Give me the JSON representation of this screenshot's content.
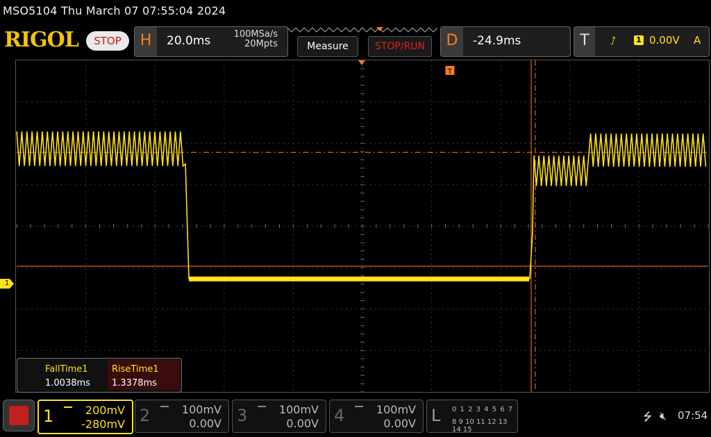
{
  "title": "MSO5104  Thu March 07 07:55:04 2024",
  "logo": "RIGOL",
  "status": "STOP",
  "horizontal": {
    "letter": "H",
    "timebase": "20.0ms",
    "sample_rate": "100MSa/s",
    "memory_depth": "20Mpts"
  },
  "buttons": {
    "measure": "Measure",
    "stop_run": "STOP/RUN"
  },
  "delay": {
    "letter": "D",
    "value": "-24.9ms"
  },
  "trigger": {
    "letter": "T",
    "edge_icon": "rising-edge-icon",
    "source": "1",
    "level": "0.00V",
    "mode": "A",
    "marker": "T"
  },
  "channel_marker": "1",
  "measurements": [
    {
      "label": "FallTime1",
      "value": "1.0038ms"
    },
    {
      "label": "RiseTime1",
      "value": "1.3378ms"
    }
  ],
  "channels": [
    {
      "num": "1",
      "scale": "200mV",
      "offset": "-280mV",
      "active": true
    },
    {
      "num": "2",
      "scale": "100mV",
      "offset": "0.00V",
      "active": false
    },
    {
      "num": "3",
      "scale": "100mV",
      "offset": "0.00V",
      "active": false
    },
    {
      "num": "4",
      "scale": "100mV",
      "offset": "0.00V",
      "active": false
    }
  ],
  "logic": {
    "letter": "L",
    "row1": "0 1 2 3  4 5 6 7",
    "row2": "8 9 10 11 12 13 14 15"
  },
  "clock": "07:54",
  "colors": {
    "ch1": "#ffe01a",
    "cursor": "#ff7a1a",
    "brand": "#f4c20d",
    "stop": "#d01818"
  }
}
